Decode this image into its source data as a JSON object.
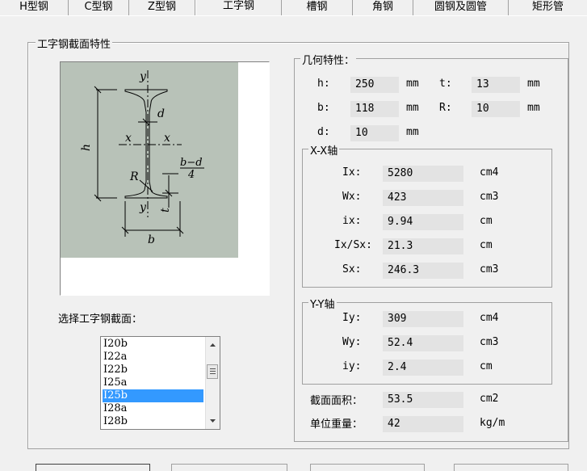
{
  "tabs": [
    "H型钢",
    "C型钢",
    "Z型钢",
    "工字钢",
    "槽钢",
    "角钢",
    "圆钢及圆管",
    "矩形管"
  ],
  "active_tab": "工字钢",
  "section_title": "工字钢截面特性",
  "diagram": {
    "y_top": "y",
    "y_bottom": "y",
    "x_left": "x",
    "x_right": "x",
    "h": "h",
    "d": "d",
    "R": "R",
    "t": "t",
    "b": "b",
    "bd_num": "b−d",
    "bd_den": "4"
  },
  "select_label": "选择工字钢截面：",
  "sections": [
    "I20b",
    "I22a",
    "I22b",
    "I25a",
    "I25b",
    "I28a",
    "I28b"
  ],
  "selected_section": "I25b",
  "geometry": {
    "title": "几何特性：",
    "h_label": "h:",
    "h_value": "250",
    "h_unit": "mm",
    "t_label": "t:",
    "t_value": "13",
    "t_unit": "mm",
    "b_label": "b:",
    "b_value": "118",
    "b_unit": "mm",
    "R_label": "R:",
    "R_value": "10",
    "R_unit": "mm",
    "d_label": "d:",
    "d_value": "10",
    "d_unit": "mm"
  },
  "xx": {
    "title": "X-X轴",
    "Ix_label": "Ix:",
    "Ix_value": "5280",
    "Ix_unit": "cm4",
    "Wx_label": "Wx:",
    "Wx_value": "423",
    "Wx_unit": "cm3",
    "ix_label": "ix:",
    "ix_value": "9.94",
    "ix_unit": "cm",
    "IxSx_label": "Ix/Sx:",
    "IxSx_value": "21.3",
    "IxSx_unit": "cm",
    "Sx_label": "Sx:",
    "Sx_value": "246.3",
    "Sx_unit": "cm3"
  },
  "yy": {
    "title": "Y-Y轴",
    "Iy_label": "Iy:",
    "Iy_value": "309",
    "Iy_unit": "cm4",
    "Wy_label": "Wy:",
    "Wy_value": "52.4",
    "Wy_unit": "cm3",
    "iy_label": "iy:",
    "iy_value": "2.4",
    "iy_unit": "cm"
  },
  "area_label": "截面面积：",
  "area_value": "53.5",
  "area_unit": "cm2",
  "weight_label": "单位重量：",
  "weight_value": "42",
  "weight_unit": "kg/m"
}
